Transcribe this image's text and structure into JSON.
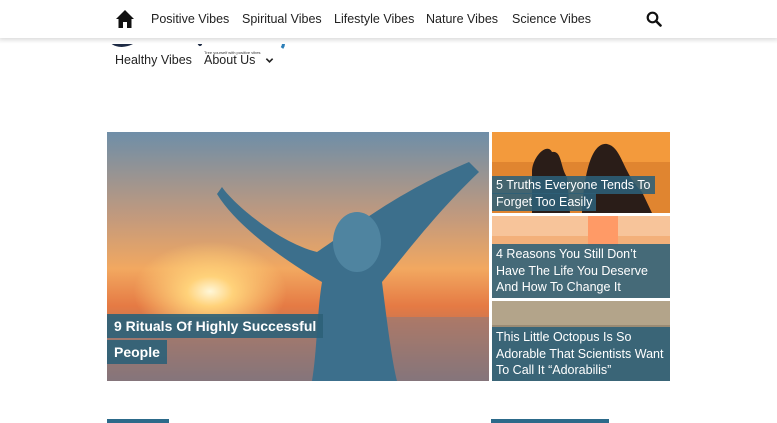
{
  "nav": {
    "items": [
      "Positive Vibes",
      "Spiritual Vibes",
      "Lifestyle Vibes",
      "Nature Vibes",
      "Science Vibes"
    ],
    "home_icon": "home-icon",
    "search_icon": "search-icon"
  },
  "logo": {
    "tagline": "Tree yourself with positive vibes"
  },
  "submenu": {
    "items": [
      "Healthy Vibes",
      "About Us"
    ]
  },
  "featured": {
    "main": {
      "title": "9 Rituals Of Highly Successful People"
    },
    "side": [
      {
        "title": "5 Truths Everyone Tends To Forget Too Easily"
      },
      {
        "title": "4 Reasons You Still Don’t Have The Life You Deserve And How To Change It"
      },
      {
        "title": "This Little Octopus Is So Adorable That Scientists Want To Call It “Adorabilis”"
      }
    ]
  },
  "colors": {
    "caption_bg": "#2c6078",
    "accent": "#2c6a8a",
    "text": "#222222"
  }
}
